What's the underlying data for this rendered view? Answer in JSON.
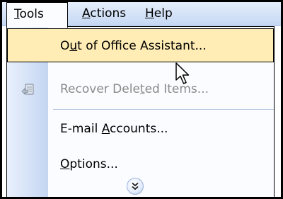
{
  "menubar": {
    "tools": {
      "pre": "",
      "key": "T",
      "post": "ools"
    },
    "actions": {
      "pre": "",
      "key": "A",
      "post": "ctions"
    },
    "help": {
      "pre": "",
      "key": "H",
      "post": "elp"
    }
  },
  "dropdown": {
    "items": [
      {
        "pre": "O",
        "key": "u",
        "post": "t of Office Assistant...",
        "state": "highlighted"
      },
      {
        "pre": "Recover Dele",
        "key": "t",
        "post": "ed Items...",
        "state": "disabled",
        "icon": "recover-deleted-icon"
      },
      {
        "pre": "E-mail ",
        "key": "A",
        "post": "ccounts...",
        "state": "enabled"
      },
      {
        "pre": "",
        "key": "O",
        "post": "ptions...",
        "state": "enabled"
      }
    ],
    "expand_icon": "double-chevron-down-icon"
  },
  "colors": {
    "menubar": "#c5d8f3",
    "highlight": "#ffedb5",
    "icon_column": "#c4d6f2",
    "disabled_text": "#8a8a8a"
  }
}
